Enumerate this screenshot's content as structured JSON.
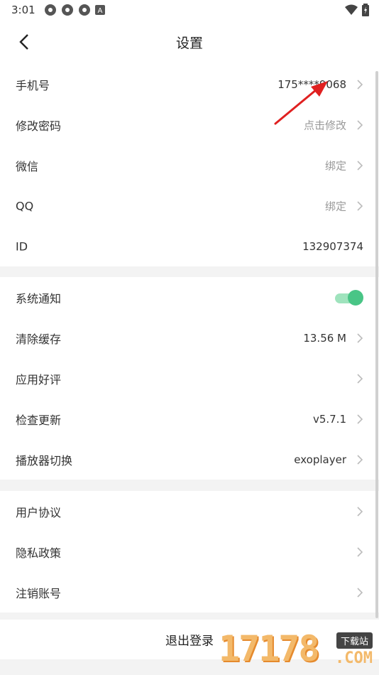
{
  "status": {
    "time": "3:01",
    "icons": [
      "app-icon",
      "app-icon",
      "app-icon",
      "notification-a-icon"
    ],
    "right_icons": [
      "wifi-icon",
      "battery-icon"
    ]
  },
  "header": {
    "title": "设置"
  },
  "account": [
    {
      "label": "手机号",
      "value": "175****9068",
      "muted": false,
      "arrow": true
    },
    {
      "label": "修改密码",
      "value": "点击修改",
      "muted": true,
      "arrow": true
    },
    {
      "label": "微信",
      "value": "绑定",
      "muted": true,
      "arrow": true
    },
    {
      "label": "QQ",
      "value": "绑定",
      "muted": true,
      "arrow": true
    },
    {
      "label": "ID",
      "value": "132907374",
      "muted": false,
      "arrow": false
    }
  ],
  "settings": [
    {
      "label": "系统通知",
      "toggle": true
    },
    {
      "label": "清除缓存",
      "value": "13.56 M"
    },
    {
      "label": "应用好评",
      "value": ""
    },
    {
      "label": "检查更新",
      "value": "v5.7.1"
    },
    {
      "label": "播放器切换",
      "value": "exoplayer"
    }
  ],
  "legal": [
    {
      "label": "用户协议"
    },
    {
      "label": "隐私政策"
    },
    {
      "label": "注销账号"
    }
  ],
  "logout": {
    "label": "退出登录"
  },
  "colors": {
    "accent": "#49c586",
    "annotation": "#e02020",
    "watermark": "#f3b96a"
  },
  "watermark": {
    "digits": "17178",
    "tag": "下载站",
    "com": ".COM"
  }
}
